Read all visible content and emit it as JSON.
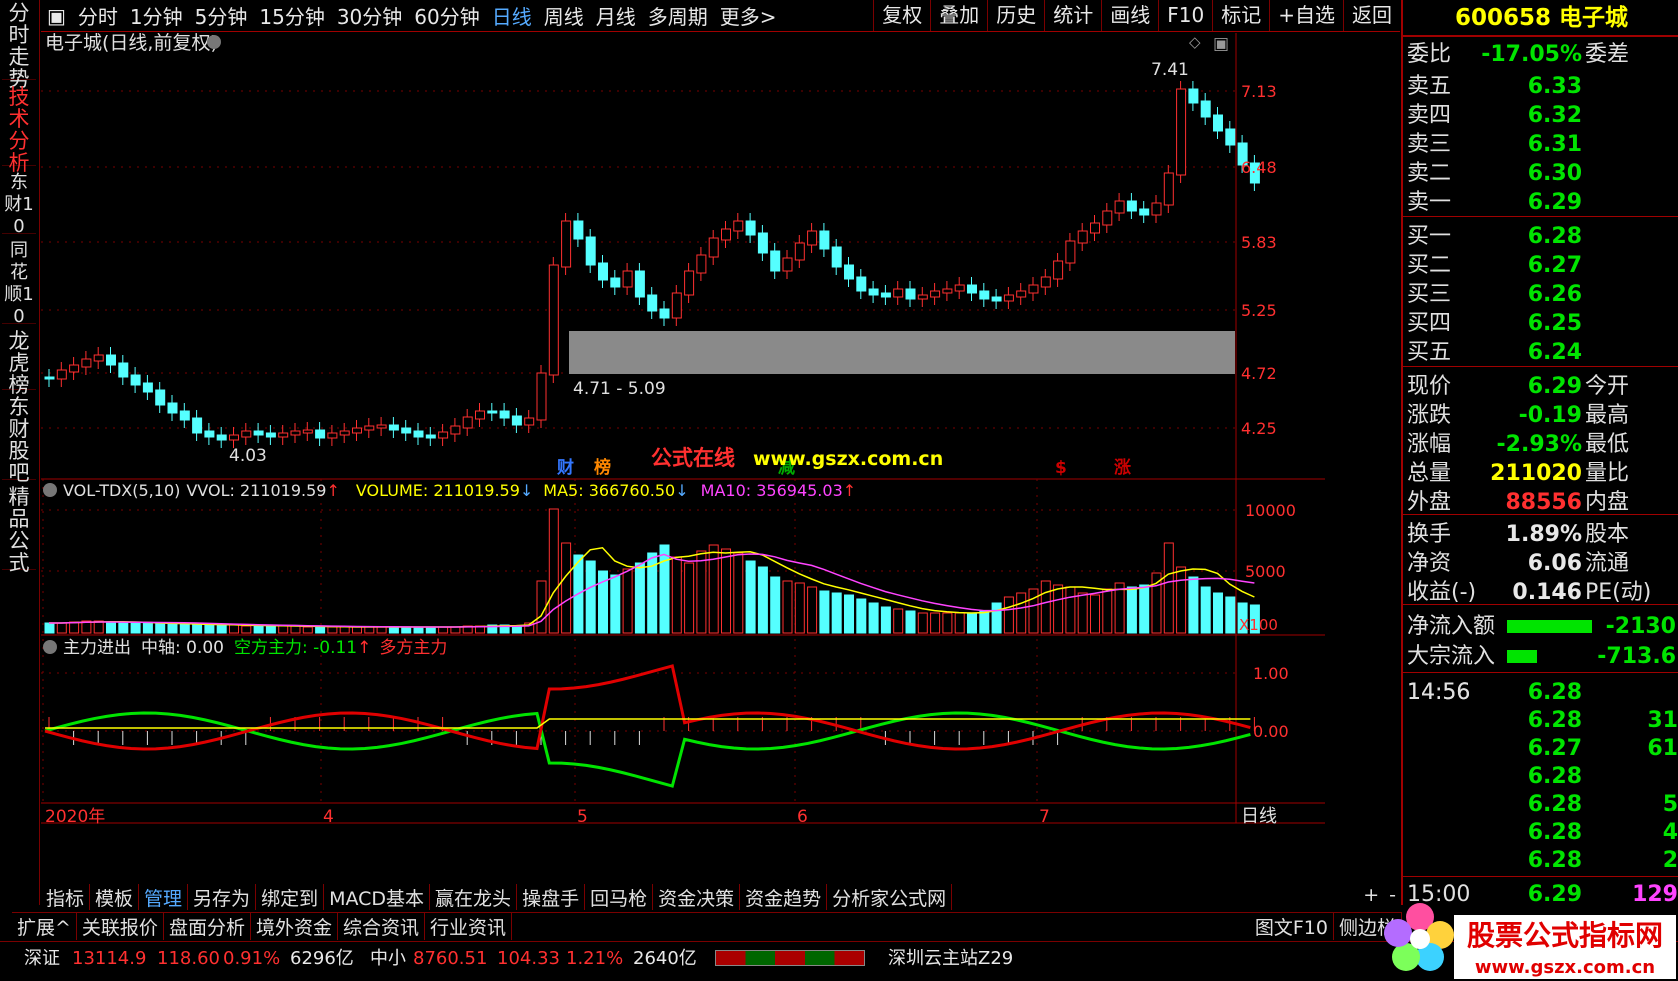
{
  "left_tabs": [
    "分时走势",
    "技术分析",
    "东财10",
    "同花顺10",
    "龙虎榜",
    "东财股吧",
    "精品公式"
  ],
  "toolbar": {
    "periods": [
      "分时",
      "1分钟",
      "5分钟",
      "15分钟",
      "30分钟",
      "60分钟",
      "日线",
      "周线",
      "月线",
      "多周期",
      "更多>"
    ],
    "selected": "日线",
    "right": [
      "复权",
      "叠加",
      "历史",
      "统计",
      "画线",
      "F10",
      "标记",
      "+自选",
      "返回"
    ]
  },
  "chart": {
    "title": "电子城(日线,前复权)",
    "y_labels": [
      "7.13",
      "6.48",
      "5.83",
      "5.25",
      "4.72",
      "4.25"
    ],
    "high_label": "7.41",
    "low_label": "4.03",
    "zone_label": "4.71 - 5.09",
    "markers": [
      "财",
      "榜",
      "减",
      "$",
      "涨"
    ],
    "x_labels": [
      "2020年",
      "4",
      "5",
      "6",
      "7"
    ],
    "period_label": "日线"
  },
  "watermark": {
    "text": "公式在线",
    "url": "www.gszx.com.cn"
  },
  "volume": {
    "name": "VOL-TDX(5,10)",
    "vvol": "VVOL: 211019.59",
    "volume": "VOLUME: 211019.59",
    "ma5": "MA5: 366760.50",
    "ma10": "MA10: 356945.03",
    "y_labels": [
      "10000",
      "5000"
    ],
    "unit": "X100"
  },
  "indicator": {
    "name": "主力进出",
    "axis": "中轴: 0.00",
    "empty": "空方主力: -0.11",
    "multi": "多方主力",
    "y_labels": [
      "1.00",
      "0.00"
    ]
  },
  "bottom_tabs": [
    "指标",
    "模板",
    "管理",
    "另存为",
    "绑定到",
    "MACD基本",
    "赢在龙头",
    "操盘手",
    "回马枪",
    "资金决策",
    "资金趋势",
    "分析家公式网"
  ],
  "bottom_tabs_selected": "管理",
  "bottom_plus": "+",
  "bottom_minus": "-",
  "ext_tabs": [
    "扩展^",
    "关联报价",
    "盘面分析",
    "境外资金",
    "综合资讯",
    "行业资讯"
  ],
  "ext_right": [
    "图文F10",
    "侧边栏"
  ],
  "status": {
    "sz_label": "深证",
    "sz_val": "13114.9",
    "sz_chg": "118.60",
    "sz_pct": "0.91%",
    "sz_amt": "6296亿",
    "zx_label": "中小",
    "zx_val": "8760.51",
    "zx_chg": "104.33",
    "zx_pct": "1.21%",
    "zx_amt": "2640亿",
    "server": "深圳云主站Z29"
  },
  "stock": {
    "code": "600658",
    "name": "电子城"
  },
  "quote": {
    "wb_label": "委比",
    "wb": "-17.05%",
    "wc_label": "委差",
    "asks": [
      [
        "卖五",
        "6.33"
      ],
      [
        "卖四",
        "6.32"
      ],
      [
        "卖三",
        "6.31"
      ],
      [
        "卖二",
        "6.30"
      ],
      [
        "卖一",
        "6.29"
      ]
    ],
    "bids": [
      [
        "买一",
        "6.28"
      ],
      [
        "买二",
        "6.27"
      ],
      [
        "买三",
        "6.26"
      ],
      [
        "买四",
        "6.25"
      ],
      [
        "买五",
        "6.24"
      ]
    ],
    "stats": [
      [
        "现价",
        "6.29",
        "今开"
      ],
      [
        "涨跌",
        "-0.19",
        "最高"
      ],
      [
        "涨幅",
        "-2.93%",
        "最低"
      ],
      [
        "总量",
        "211020",
        "量比"
      ],
      [
        "外盘",
        "88556",
        "内盘"
      ]
    ],
    "stats2": [
      [
        "换手",
        "1.89%",
        "股本"
      ],
      [
        "净资",
        "6.06",
        "流通"
      ],
      [
        "收益(-)",
        "0.146",
        "PE(动)"
      ]
    ],
    "flow": [
      [
        "净流入额",
        "-2130"
      ],
      [
        "大宗流入",
        "-713.6"
      ]
    ]
  },
  "ticks": {
    "time1": "14:56",
    "prices": [
      "6.28",
      "6.28",
      "6.27",
      "6.28",
      "6.28",
      "6.28",
      "6.28"
    ],
    "vols": [
      "",
      "31",
      "61",
      "",
      "5",
      "4",
      "2"
    ],
    "time2": "15:00",
    "price2": "6.29",
    "vol2": "129"
  },
  "logo": {
    "text": "股票公式指标网",
    "url": "www.gszx.com.cn"
  }
}
